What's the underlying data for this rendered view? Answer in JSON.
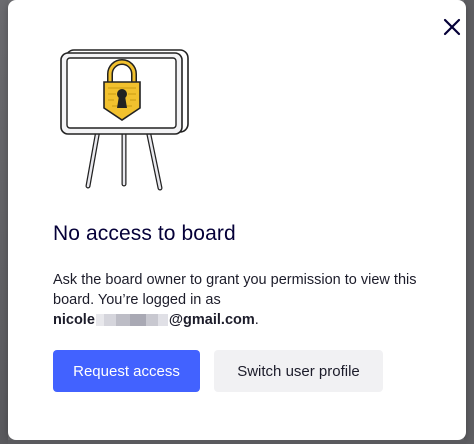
{
  "dialog": {
    "title": "No access to board",
    "message": "Ask the board owner to grant you permission to view this board. You’re logged in as",
    "email_prefix": "nicole",
    "email_suffix": "@gmail.com",
    "email_trailing": ".",
    "close_icon": "close-icon",
    "illustration_icon": "locked-board-icon"
  },
  "actions": {
    "request_access_label": "Request access",
    "switch_profile_label": "Switch user profile"
  },
  "colors": {
    "primary": "#4262ff",
    "title": "#050038",
    "lock": "#f2c12e"
  }
}
